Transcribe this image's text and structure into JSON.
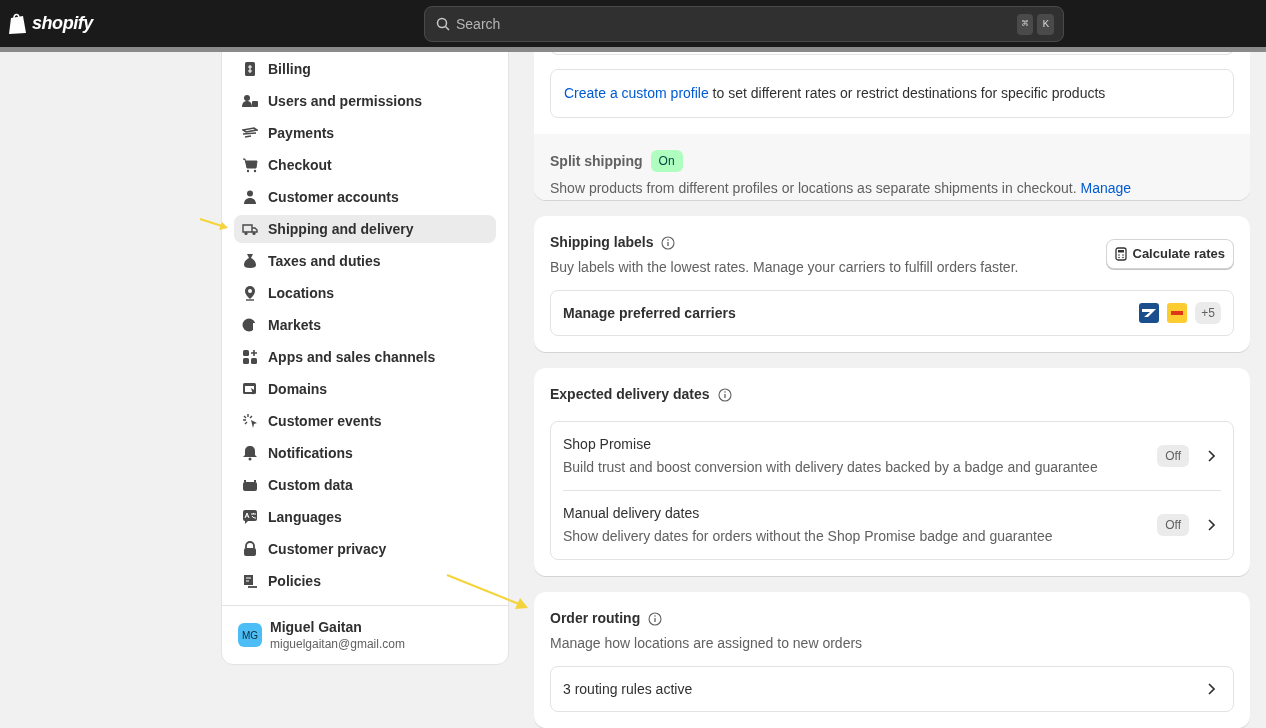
{
  "topbar": {
    "logo": "shopify",
    "search": {
      "placeholder": "Search",
      "shortcut_keys": [
        "⌘",
        "K"
      ]
    }
  },
  "sidebar": {
    "items": [
      {
        "label": "Billing",
        "selected": false
      },
      {
        "label": "Users and permissions",
        "selected": false
      },
      {
        "label": "Payments",
        "selected": false
      },
      {
        "label": "Checkout",
        "selected": false
      },
      {
        "label": "Customer accounts",
        "selected": false
      },
      {
        "label": "Shipping and delivery",
        "selected": true
      },
      {
        "label": "Taxes and duties",
        "selected": false
      },
      {
        "label": "Locations",
        "selected": false
      },
      {
        "label": "Markets",
        "selected": false
      },
      {
        "label": "Apps and sales channels",
        "selected": false
      },
      {
        "label": "Domains",
        "selected": false
      },
      {
        "label": "Customer events",
        "selected": false
      },
      {
        "label": "Notifications",
        "selected": false
      },
      {
        "label": "Custom data",
        "selected": false
      },
      {
        "label": "Languages",
        "selected": false
      },
      {
        "label": "Customer privacy",
        "selected": false
      },
      {
        "label": "Policies",
        "selected": false
      }
    ],
    "user": {
      "initials": "MG",
      "name": "Miguel Gaitan",
      "email": "miguelgaitan@gmail.com"
    }
  },
  "custom_profile": {
    "link": "Create a custom profile",
    "text": " to set different rates or restrict destinations for specific products"
  },
  "split_shipping": {
    "title": "Split shipping",
    "status": "On",
    "on": true,
    "description": "Show products from different profiles or locations as separate shipments in checkout.",
    "link": "Manage"
  },
  "shipping_labels": {
    "title": "Shipping labels",
    "description": "Buy labels with the lowest rates. Manage your carriers to fulfill orders faster.",
    "button": "Calculate rates",
    "carriers": {
      "label": "Manage preferred carriers",
      "more": "+5"
    }
  },
  "expected_delivery": {
    "title": "Expected delivery dates",
    "items": [
      {
        "title": "Shop Promise",
        "description": "Build trust and boost conversion with delivery dates backed by a badge and guarantee",
        "status": "Off",
        "on": false
      },
      {
        "title": "Manual delivery dates",
        "description": "Show delivery dates for orders without the Shop Promise badge and guarantee",
        "status": "Off",
        "on": false
      }
    ]
  },
  "order_routing": {
    "title": "Order routing",
    "description": "Manage how locations are assigned to new orders",
    "row": "3 routing rules active"
  }
}
